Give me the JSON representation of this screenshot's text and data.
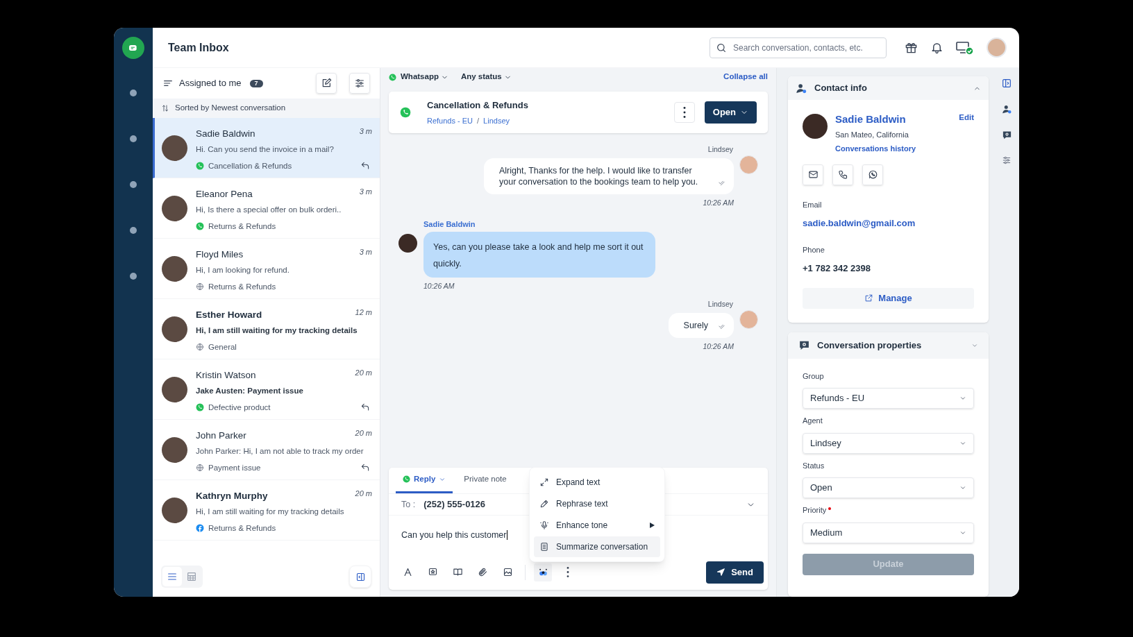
{
  "app": {
    "title": "Team Inbox"
  },
  "top_bar": {
    "search": {
      "placeholder": "Search conversation, contacts, etc."
    },
    "agent_online": true
  },
  "list_header": {
    "filter": "Assigned to me",
    "count": "7",
    "sort": "Sorted by Newest conversation"
  },
  "conversations": [
    {
      "name": "Sadie Baldwin",
      "preview": "Hi. Can you send the invoice in a mail?",
      "time": "3 m",
      "kind": "whatsapp",
      "tag": "Cancellation & Refunds",
      "name_bold": false,
      "preview_bold": false,
      "replied": true,
      "selected": true
    },
    {
      "name": "Eleanor Pena",
      "preview": "Hi, Is there a special offer on bulk orderi..",
      "time": "3 m",
      "kind": "whatsapp",
      "tag": "Returns & Refunds",
      "name_bold": false,
      "preview_bold": false,
      "replied": false,
      "selected": false
    },
    {
      "name": "Floyd Miles",
      "preview": "Hi, I am looking for refund.",
      "time": "3 m",
      "kind": "web",
      "tag": "Returns & Refunds",
      "name_bold": false,
      "preview_bold": false,
      "replied": false,
      "selected": false
    },
    {
      "name": "Esther Howard",
      "preview": "Hi, I am still waiting for my tracking details",
      "time": "12 m",
      "kind": "web",
      "tag": "General",
      "name_bold": true,
      "preview_bold": true,
      "replied": false,
      "selected": false
    },
    {
      "name": "Kristin Watson",
      "preview": "Jake Austen: Payment issue",
      "time": "20 m",
      "kind": "whatsapp",
      "tag": "Defective product",
      "name_bold": false,
      "preview_bold": true,
      "replied": true,
      "selected": false
    },
    {
      "name": "John Parker",
      "preview": "John Parker: Hi, I am not able to track my order",
      "time": "20 m",
      "kind": "web",
      "tag": "Payment issue",
      "name_bold": false,
      "preview_bold": false,
      "replied": true,
      "selected": false
    },
    {
      "name": "Kathryn Murphy",
      "preview": "Hi, I am still waiting for my tracking details",
      "time": "20 m",
      "kind": "facebook",
      "tag": "Returns & Refunds",
      "name_bold": true,
      "preview_bold": false,
      "replied": false,
      "selected": false
    }
  ],
  "list_views": [
    {
      "kind": "list",
      "selected": true
    },
    {
      "kind": "grid",
      "selected": false
    }
  ],
  "filters": {
    "channel": "Whatsapp",
    "status": "Any status",
    "collapse": "Collapse all"
  },
  "conversation": {
    "title": "Cancellation & Refunds",
    "group": "Refunds - EU",
    "separator": "/",
    "agent": "Lindsey",
    "status": "Open"
  },
  "messages": [
    {
      "kind": "out",
      "sender": "Lindsey",
      "text": "Alright, Thanks for the help. I would like to transfer your conversation to the bookings team to help you.",
      "time": "10:26 AM"
    },
    {
      "kind": "in",
      "sender": "Sadie Baldwin",
      "text": "Yes, can you please take a look and help me sort it out quickly.",
      "time": "10:26 AM"
    },
    {
      "kind": "out",
      "sender": "Lindsey",
      "text": "Surely",
      "time": "10:26 AM"
    }
  ],
  "composer": {
    "tabs": [
      {
        "label": "Reply",
        "selected": true
      },
      {
        "label": "Private note",
        "selected": false
      }
    ],
    "to_label": "To :",
    "to": "(252) 555-0126",
    "value": "Can you help this customer",
    "tools": [
      {
        "kind": "format",
        "active": false
      },
      {
        "kind": "snippet",
        "active": false
      },
      {
        "kind": "knowledge",
        "active": false
      },
      {
        "kind": "attach",
        "active": false
      },
      {
        "kind": "image",
        "active": false
      },
      {
        "kind": "ai",
        "active": true
      },
      {
        "kind": "more",
        "active": false
      }
    ],
    "send": "Send"
  },
  "ai_menu": [
    {
      "kind": "expand",
      "label": "Expand text",
      "submenu": false,
      "highlighted": false
    },
    {
      "kind": "rephrase",
      "label": "Rephrase text",
      "submenu": false,
      "highlighted": false
    },
    {
      "kind": "tone",
      "label": "Enhance tone",
      "submenu": true,
      "highlighted": false
    },
    {
      "kind": "summarize",
      "label": "Summarize conversation",
      "submenu": false,
      "highlighted": true
    }
  ],
  "contact_info": {
    "title": "Contact info",
    "expanded": true,
    "name": "Sadie Baldwin",
    "location": "San Mateo, California",
    "history": "Conversations history",
    "edit": "Edit",
    "fields": [
      {
        "label": "Email",
        "value": "sadie.baldwin@gmail.com",
        "kind": "link"
      },
      {
        "label": "Phone",
        "value": "+1 782 342 2398",
        "kind": "text"
      }
    ],
    "manage": "Manage"
  },
  "properties": {
    "title": "Conversation properties",
    "expanded": false,
    "fields": [
      {
        "label": "Group",
        "value": "Refunds - EU",
        "required": false
      },
      {
        "label": "Agent",
        "value": "Lindsey",
        "required": false
      },
      {
        "label": "Status",
        "value": "Open",
        "required": false
      },
      {
        "label": "Priority",
        "value": "Medium",
        "required": true
      }
    ],
    "update": {
      "label": "Update",
      "disabled": true
    }
  }
}
